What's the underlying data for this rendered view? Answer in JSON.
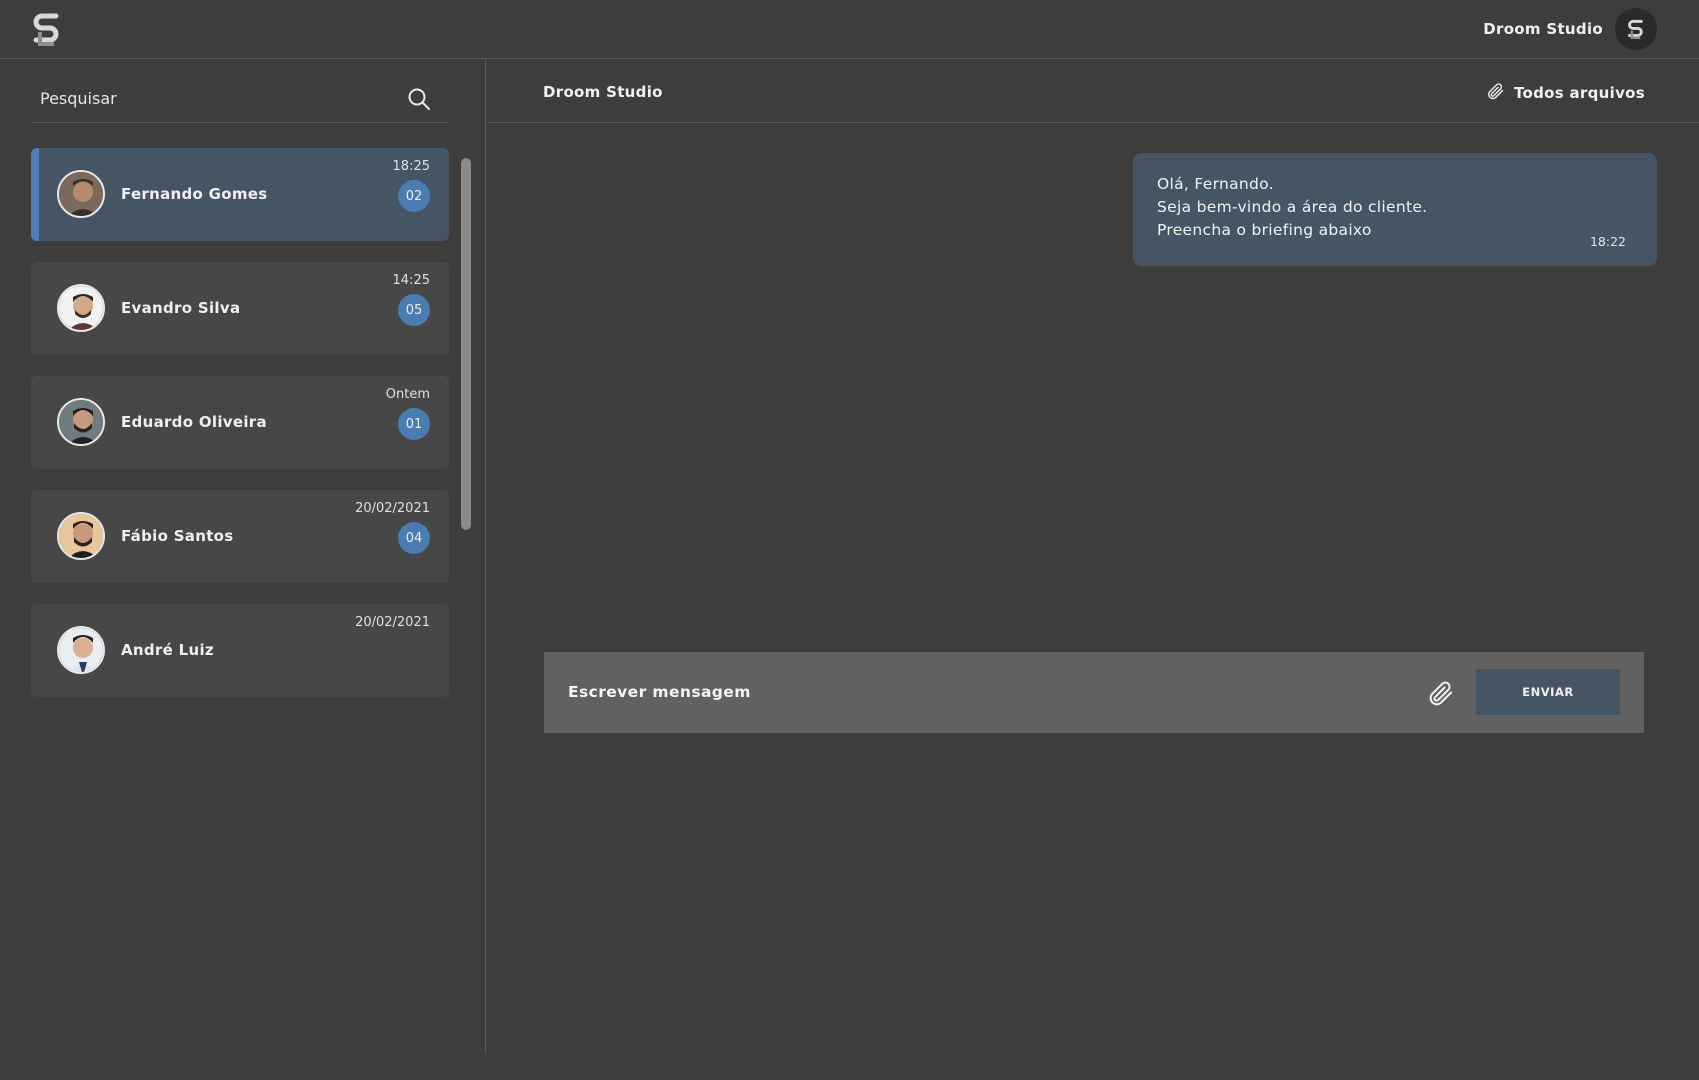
{
  "header": {
    "logo_icon": "s-logo-icon",
    "user_name": "Droom Studio",
    "user_avatar_icon": "s-logo-icon"
  },
  "sidebar": {
    "search": {
      "placeholder": "Pesquisar",
      "icon": "search-icon"
    },
    "contacts": [
      {
        "name": "Fernando Gomes",
        "time": "18:25",
        "badge": "02",
        "active": true
      },
      {
        "name": "Evandro Silva",
        "time": "14:25",
        "badge": "05",
        "active": false
      },
      {
        "name": "Eduardo Oliveira",
        "time": "Ontem",
        "badge": "01",
        "active": false
      },
      {
        "name": "Fábio Santos",
        "time": "20/02/2021",
        "badge": "04",
        "active": false
      },
      {
        "name": "André Luiz",
        "time": "20/02/2021",
        "badge": "",
        "active": false
      }
    ]
  },
  "chat": {
    "title": "Droom Studio",
    "files_label": "Todos arquivos",
    "files_icon": "paperclip-icon",
    "messages": [
      {
        "lines": [
          "Olá, Fernando.",
          "Seja bem-vindo a área do cliente.",
          "Preencha o briefing abaixo"
        ],
        "time": "18:22"
      }
    ],
    "composer": {
      "placeholder": "Escrever mensagem",
      "attach_icon": "paperclip-icon",
      "send_label": "ENVIAR"
    }
  },
  "colors": {
    "background": "#3d3d3d",
    "active_contact": "#465563",
    "accent": "#4a7cb0",
    "composer": "#616161"
  }
}
